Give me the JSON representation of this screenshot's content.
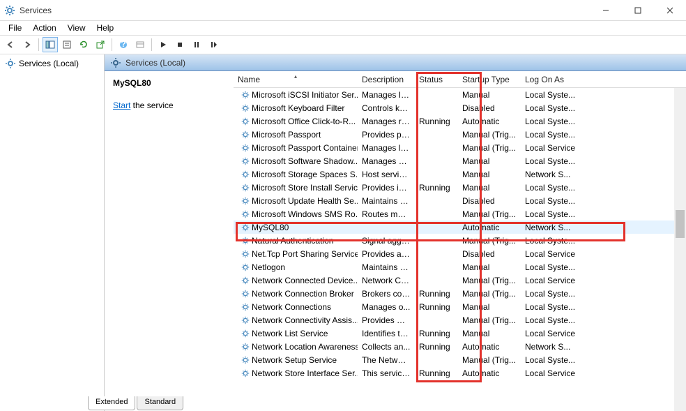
{
  "window": {
    "title": "Services"
  },
  "menu": {
    "file": "File",
    "action": "Action",
    "view": "View",
    "help": "Help"
  },
  "tree": {
    "root": "Services (Local)"
  },
  "detail_header": "Services (Local)",
  "info_panel": {
    "selected_name": "MySQL80",
    "start_link": "Start",
    "start_suffix": " the service"
  },
  "columns": {
    "name": "Name",
    "desc": "Description",
    "status": "Status",
    "startup": "Startup Type",
    "logon": "Log On As"
  },
  "tabs": {
    "extended": "Extended",
    "standard": "Standard"
  },
  "services": [
    {
      "name": "Microsoft iSCSI Initiator Ser...",
      "desc": "Manages In...",
      "status": "",
      "startup": "Manual",
      "logon": "Local Syste..."
    },
    {
      "name": "Microsoft Keyboard Filter",
      "desc": "Controls ke...",
      "status": "",
      "startup": "Disabled",
      "logon": "Local Syste..."
    },
    {
      "name": "Microsoft Office Click-to-R...",
      "desc": "Manages re...",
      "status": "Running",
      "startup": "Automatic",
      "logon": "Local Syste..."
    },
    {
      "name": "Microsoft Passport",
      "desc": "Provides pr...",
      "status": "",
      "startup": "Manual (Trig...",
      "logon": "Local Syste..."
    },
    {
      "name": "Microsoft Passport Container",
      "desc": "Manages lo...",
      "status": "",
      "startup": "Manual (Trig...",
      "logon": "Local Service"
    },
    {
      "name": "Microsoft Software Shadow...",
      "desc": "Manages so...",
      "status": "",
      "startup": "Manual",
      "logon": "Local Syste..."
    },
    {
      "name": "Microsoft Storage Spaces S...",
      "desc": "Host service...",
      "status": "",
      "startup": "Manual",
      "logon": "Network S..."
    },
    {
      "name": "Microsoft Store Install Service",
      "desc": "Provides inf...",
      "status": "Running",
      "startup": "Manual",
      "logon": "Local Syste..."
    },
    {
      "name": "Microsoft Update Health Se...",
      "desc": "Maintains U...",
      "status": "",
      "startup": "Disabled",
      "logon": "Local Syste..."
    },
    {
      "name": "Microsoft Windows SMS Ro...",
      "desc": "Routes mes...",
      "status": "",
      "startup": "Manual (Trig...",
      "logon": "Local Syste..."
    },
    {
      "name": "MySQL80",
      "desc": "",
      "status": "",
      "startup": "Automatic",
      "logon": "Network S...",
      "selected": true
    },
    {
      "name": "Natural Authentication",
      "desc": "Signal aggr...",
      "status": "",
      "startup": "Manual (Trig...",
      "logon": "Local Syste..."
    },
    {
      "name": "Net.Tcp Port Sharing Service",
      "desc": "Provides abi...",
      "status": "",
      "startup": "Disabled",
      "logon": "Local Service"
    },
    {
      "name": "Netlogon",
      "desc": "Maintains a ...",
      "status": "",
      "startup": "Manual",
      "logon": "Local Syste..."
    },
    {
      "name": "Network Connected Device...",
      "desc": "Network Co...",
      "status": "",
      "startup": "Manual (Trig...",
      "logon": "Local Service"
    },
    {
      "name": "Network Connection Broker",
      "desc": "Brokers con...",
      "status": "Running",
      "startup": "Manual (Trig...",
      "logon": "Local Syste..."
    },
    {
      "name": "Network Connections",
      "desc": "Manages o...",
      "status": "Running",
      "startup": "Manual",
      "logon": "Local Syste..."
    },
    {
      "name": "Network Connectivity Assis...",
      "desc": "Provides Dir...",
      "status": "",
      "startup": "Manual (Trig...",
      "logon": "Local Syste..."
    },
    {
      "name": "Network List Service",
      "desc": "Identifies th...",
      "status": "Running",
      "startup": "Manual",
      "logon": "Local Service"
    },
    {
      "name": "Network Location Awareness",
      "desc": "Collects an...",
      "status": "Running",
      "startup": "Automatic",
      "logon": "Network S..."
    },
    {
      "name": "Network Setup Service",
      "desc": "The Networ...",
      "status": "",
      "startup": "Manual (Trig...",
      "logon": "Local Syste..."
    },
    {
      "name": "Network Store Interface Ser...",
      "desc": "This service ...",
      "status": "Running",
      "startup": "Automatic",
      "logon": "Local Service"
    }
  ]
}
